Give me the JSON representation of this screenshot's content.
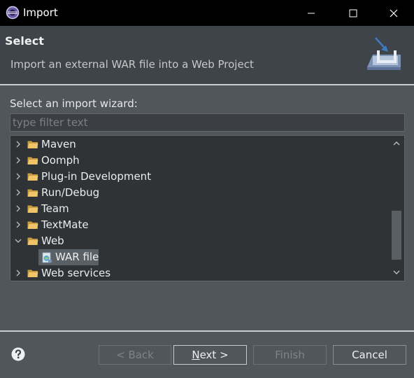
{
  "window": {
    "title": "Import"
  },
  "banner": {
    "title": "Select",
    "description": "Import an external WAR file into a Web Project"
  },
  "wizard": {
    "prompt": "Select an import wizard:",
    "filter_placeholder": "type filter text",
    "filter_value": ""
  },
  "tree": {
    "items": [
      {
        "label": "Maven",
        "expanded": false,
        "icon": "folder-icon"
      },
      {
        "label": "Oomph",
        "expanded": false,
        "icon": "folder-icon"
      },
      {
        "label": "Plug-in Development",
        "expanded": false,
        "icon": "folder-icon"
      },
      {
        "label": "Run/Debug",
        "expanded": false,
        "icon": "folder-icon"
      },
      {
        "label": "Team",
        "expanded": false,
        "icon": "folder-icon"
      },
      {
        "label": "TextMate",
        "expanded": false,
        "icon": "folder-icon"
      },
      {
        "label": "Web",
        "expanded": true,
        "icon": "folder-icon"
      },
      {
        "label": "WAR file",
        "child": true,
        "selected": true,
        "icon": "war-file-icon"
      },
      {
        "label": "Web services",
        "expanded": false,
        "icon": "folder-icon"
      }
    ]
  },
  "buttons": {
    "back": "< Back",
    "next_mnemonic": "N",
    "next_rest": "ext >",
    "finish": "Finish",
    "cancel": "Cancel"
  },
  "colors": {
    "background": "#50565c",
    "banner": "#3e4449",
    "tree_background": "#2f3336",
    "folder": "#e9b85c",
    "selection": "#5a6166"
  }
}
